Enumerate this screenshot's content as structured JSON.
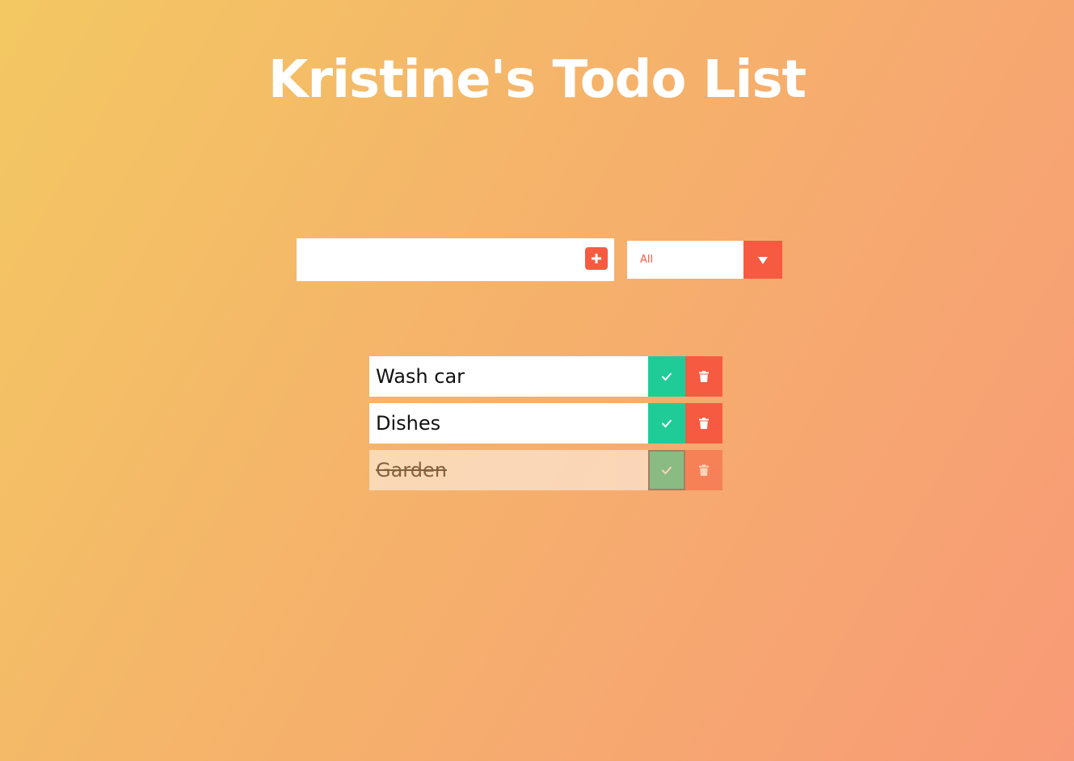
{
  "header": {
    "title": "Kristine's Todo List"
  },
  "form": {
    "input_value": "",
    "input_placeholder": "",
    "add_icon": "plus-square-icon"
  },
  "filter": {
    "selected": "All",
    "arrow_icon": "caret-down-icon"
  },
  "todos": [
    {
      "text": "Wash car",
      "completed": false
    },
    {
      "text": "Dishes",
      "completed": false
    },
    {
      "text": "Garden",
      "completed": true
    }
  ],
  "colors": {
    "accent": "#f65a41",
    "complete": "#1fcc98",
    "background_start": "#f3c862",
    "background_end": "#f89a77"
  }
}
